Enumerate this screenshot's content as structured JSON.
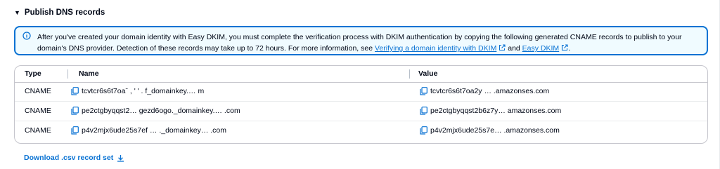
{
  "section": {
    "title": "Publish DNS records"
  },
  "alert": {
    "text_before": "After you've created your domain identity with Easy DKIM, you must complete the verification process with DKIM authentication by copying the following generated CNAME records to publish to your domain's DNS provider. Detection of these records may take up to 72 hours. For more information, see ",
    "link1": "Verifying a domain identity with DKIM",
    "text_middle": " and ",
    "link2": "Easy DKIM",
    "text_after": "."
  },
  "table": {
    "headers": {
      "type": "Type",
      "name": "Name",
      "value": "Value"
    },
    "rows": [
      {
        "type": "CNAME",
        "name": "tcvtcr6s6t7oaˉ , ' ' . f_domainkey.… m",
        "value": "tcvtcr6s6t7oa2y … .amazonses.com"
      },
      {
        "type": "CNAME",
        "name": "pe2ctgbyqqst2… gezd6ogo._domainkey.… .com",
        "value": "pe2ctgbyqqst2b6z7y… amazonses.com"
      },
      {
        "type": "CNAME",
        "name": "p4v2mjx6ude25s7ef … ._domainkey… .com",
        "value": "p4v2mjx6ude25s7e… .amazonses.com"
      }
    ]
  },
  "download": {
    "label": "Download .csv record set"
  },
  "colors": {
    "link": "#0972d3",
    "alert_border": "#0972d3",
    "alert_bg": "#f0fbff",
    "text": "#000716"
  },
  "icons": {
    "caret": "caret-down-icon",
    "info": "info-icon",
    "external": "external-link-icon",
    "copy": "copy-icon",
    "download": "download-icon"
  }
}
